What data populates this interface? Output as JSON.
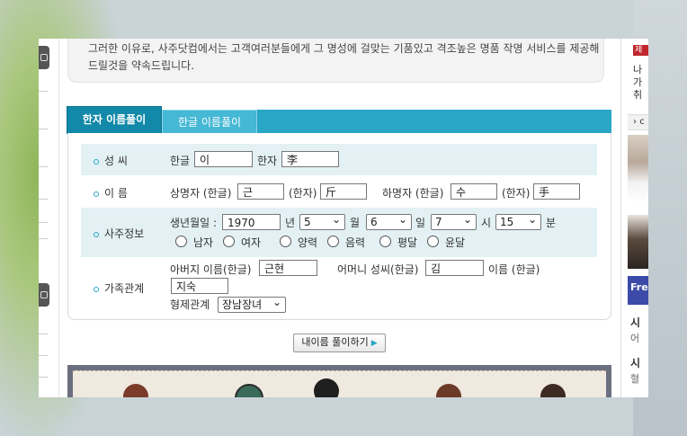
{
  "intro": {
    "text": "그러한 이유로, 사주닷컴에서는 고객여러분들에게 그 명성에 걸맞는 기품있고 격조높은 명품 작명 서비스를 제공해 드릴것을 약속드립니다."
  },
  "tabs": [
    {
      "label": "한자 이름풀이",
      "active": true
    },
    {
      "label": "한글 이름풀이",
      "active": false
    }
  ],
  "form": {
    "surname": {
      "label": "성 씨",
      "hangul_label": "한글",
      "hangul_value": "이",
      "hanja_label": "한자",
      "hanja_value": "李"
    },
    "name": {
      "label": "이 름",
      "upper_label": "상명자 (한글)",
      "upper_hangul": "근",
      "upper_hanja_label": "(한자)",
      "upper_hanja": "斤",
      "lower_label": "하명자 (한글)",
      "lower_hangul": "수",
      "lower_hanja_label": "(한자)",
      "lower_hanja": "手"
    },
    "saju": {
      "label": "사주정보",
      "birth_label": "생년월일 :",
      "year": "1970",
      "year_unit": "년",
      "month": "5",
      "month_unit": "월",
      "day": "6",
      "day_unit": "일",
      "hour": "7",
      "hour_unit": "시",
      "minute": "15",
      "minute_unit": "분",
      "gender_male": "남자",
      "gender_female": "여자",
      "cal_solar": "양력",
      "cal_lunar": "음력",
      "leap_normal": "평달",
      "leap_leap": "윤달"
    },
    "family": {
      "label": "가족관계",
      "father_label": "아버지 이름(한글)",
      "father_value": "근현",
      "mother_surname_label": "어머니 성씨(한글)",
      "mother_surname_value": "김",
      "mother_name_label": "이름 (한글)",
      "mother_name_value": "지숙",
      "sibling_label": "형제관계",
      "sibling_value": "장남장녀"
    }
  },
  "submit_label": "내이름 풀이하기",
  "sidebar": {
    "badge": "제",
    "lines": [
      "나",
      "가",
      "취"
    ],
    "section_header": "c",
    "free_label": "Free",
    "item1_title": "시",
    "item1_sub": "어",
    "item2_title": "시",
    "item2_sub": "혈"
  },
  "colors": {
    "tab_active": "#1289a8",
    "tab_bar": "#2aa6c6",
    "row_shade": "#e3f1f5",
    "badge_red": "#c0282d",
    "free_blue": "#3c4ba8"
  }
}
